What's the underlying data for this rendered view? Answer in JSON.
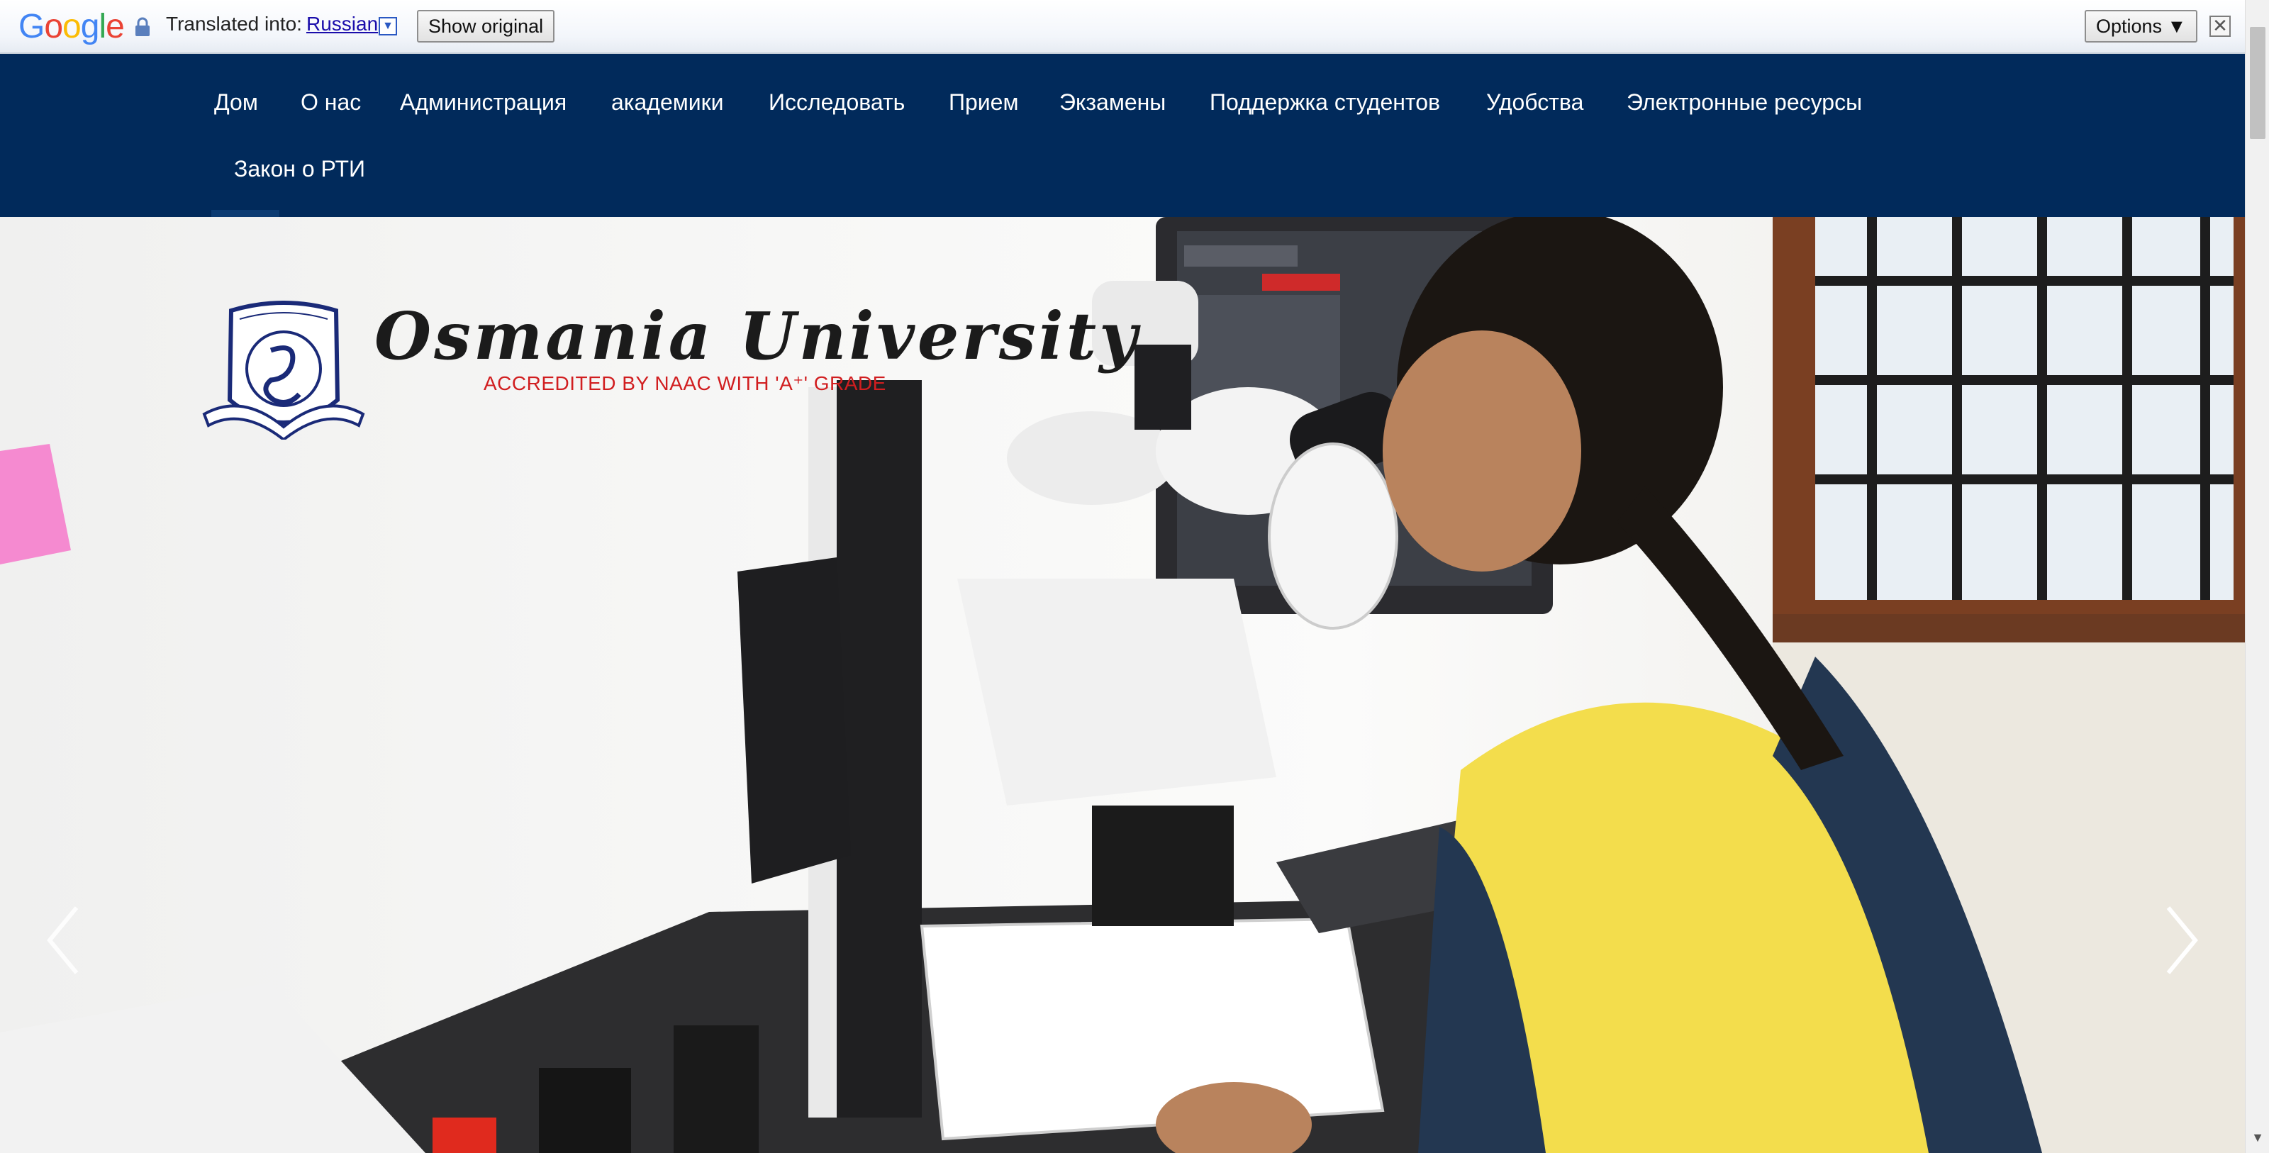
{
  "translate_bar": {
    "logo": [
      "G",
      "o",
      "o",
      "g",
      "l",
      "e"
    ],
    "logo_colors": [
      "#4285f4",
      "#ea4335",
      "#fbbc05",
      "#4285f4",
      "#34a853",
      "#ea4335"
    ],
    "translated_into": "Translated into:",
    "language": "Russian",
    "language_dropdown_icon": "▼",
    "show_original": "Show original",
    "options": "Options ▼",
    "close_icon": "✕"
  },
  "nav": {
    "items": [
      "Дом",
      "О нас",
      "Администрация",
      "академики",
      "Исследовать",
      "Прием",
      "Экзамены",
      "Поддержка студентов",
      "Удобства",
      "Электронные ресурсы",
      "Закон о РТИ"
    ]
  },
  "hero": {
    "university_name": "Osmania University",
    "accreditation": "ACCREDITED BY NAAC WITH  'A⁺'  GRADE",
    "prev_icon": "chevron-left-icon",
    "next_icon": "chevron-right-icon"
  },
  "colors": {
    "nav_bg": "#012a5b",
    "accent_red": "#d11e20",
    "link_blue": "#1a0dab"
  }
}
